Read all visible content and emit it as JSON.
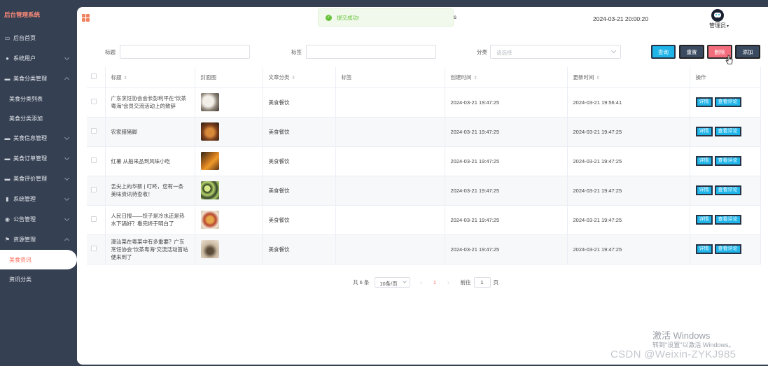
{
  "sidebar": {
    "brand": "后台管理系统",
    "items": [
      {
        "label": "后台首页",
        "icon": "monitor-icon"
      },
      {
        "label": "系统用户",
        "icon": "user-icon"
      },
      {
        "label": "美食分类管理",
        "icon": "book-icon",
        "sub": [
          "美食分类列表",
          "美食分类添加"
        ]
      },
      {
        "label": "美食信息管理",
        "icon": "book-icon"
      },
      {
        "label": "美食订单管理",
        "icon": "book-icon"
      },
      {
        "label": "美食评价管理",
        "icon": "book-icon"
      },
      {
        "label": "系统管理",
        "icon": "bar-chart-icon"
      },
      {
        "label": "公告管理",
        "icon": "info-icon"
      },
      {
        "label": "资源管理",
        "icon": "flag-icon",
        "sub": [
          "美食资讯",
          "资讯分类"
        ]
      }
    ],
    "active_sub": "美食资讯"
  },
  "header": {
    "toast": "提交成功!",
    "toast_tail": "s",
    "datetime": "2024-03-21 20:00:20",
    "user": "管理员"
  },
  "search": {
    "title_label": "标题",
    "tag_label": "标签",
    "category_label": "分类",
    "category_placeholder": "请选择",
    "query_btn": "查询",
    "reset_btn": "重置",
    "delete_btn": "删除",
    "add_btn": "添加"
  },
  "table": {
    "headers": [
      "标题",
      "封面图",
      "文章分类",
      "标签",
      "创建时间",
      "更新时间",
      "操作"
    ],
    "rows": [
      {
        "title": "广东烹饪协会会长彭利平在“饮茶粤海”会员交流活动上的致辞",
        "category": "美食餐饮",
        "tag": "",
        "created": "2024-03-21 19:47:25",
        "updated": "2024-03-21 19:56:41"
      },
      {
        "title": "农家腊猪脚",
        "category": "美食餐饮",
        "tag": "",
        "created": "2024-03-21 19:47:25",
        "updated": "2024-03-21 19:47:25"
      },
      {
        "title": "红薯 从舶来品到风味小吃",
        "category": "美食餐饮",
        "tag": "",
        "created": "2024-03-21 19:47:25",
        "updated": "2024-03-21 19:47:25"
      },
      {
        "title": "舌尖上的华新 | 叮咚，您有一条美味资讯待查收！",
        "category": "美食餐饮",
        "tag": "",
        "created": "2024-03-21 19:47:25",
        "updated": "2024-03-21 19:47:25"
      },
      {
        "title": "人民日报——饺子是冷水还是热水下锅好？看完终于明白了",
        "category": "美食餐饮",
        "tag": "",
        "created": "2024-03-21 19:47:25",
        "updated": "2024-03-21 19:47:25"
      },
      {
        "title": "潮汕菜在粤菜中有多重要？广东烹饪协会“饮茶粤海”交流活动首站便来到了",
        "category": "美食餐饮",
        "tag": "",
        "created": "2024-03-21 19:47:25",
        "updated": "2024-03-21 19:47:25"
      }
    ],
    "detail_btn": "详情",
    "comment_btn": "查看评论"
  },
  "pagination": {
    "total": "共 6 条",
    "page_size": "10条/页",
    "prev": "‹",
    "current": "1",
    "next": "›",
    "goto": "前往",
    "jump_value": "1",
    "unit": "页"
  },
  "watermark": {
    "activate": "激活 Windows",
    "activate_hint": "转到\"设置\"以激活 Windows。",
    "csdn": "CSDN @Weixin-ZYKJ985"
  },
  "colors": {
    "accent": "#ff6b5a",
    "button_blue": "#1fb5e9",
    "delete_red": "#f46d7d",
    "sidebar_bg": "#354052"
  }
}
